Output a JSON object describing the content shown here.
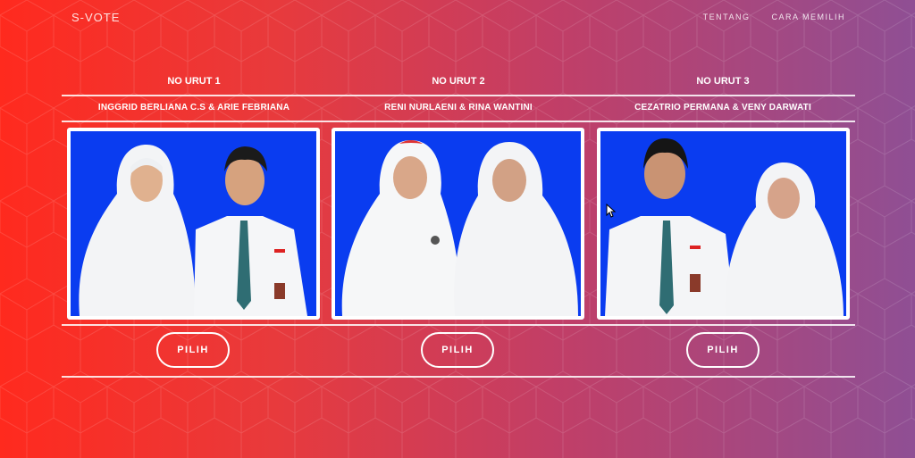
{
  "brand": "S-VOTE",
  "nav": {
    "about": "TENTANG",
    "how_to": "CARA MEMILIH"
  },
  "candidates": [
    {
      "number_label": "NO URUT 1",
      "names": "INGGRID BERLIANA C.S & ARIE FEBRIANA",
      "button": "PILIH"
    },
    {
      "number_label": "NO URUT 2",
      "names": "RENI NURLAENI & RINA WANTINI",
      "button": "PILIH"
    },
    {
      "number_label": "NO URUT 3",
      "names": "CEZATRIO PERMANA & VENY DARWATI",
      "button": "PILIH"
    }
  ],
  "colors": {
    "gradient_start": "#ff2a1e",
    "gradient_end": "#8f4f94",
    "photo_background": "#0a3cf0",
    "text": "#ffffff"
  }
}
